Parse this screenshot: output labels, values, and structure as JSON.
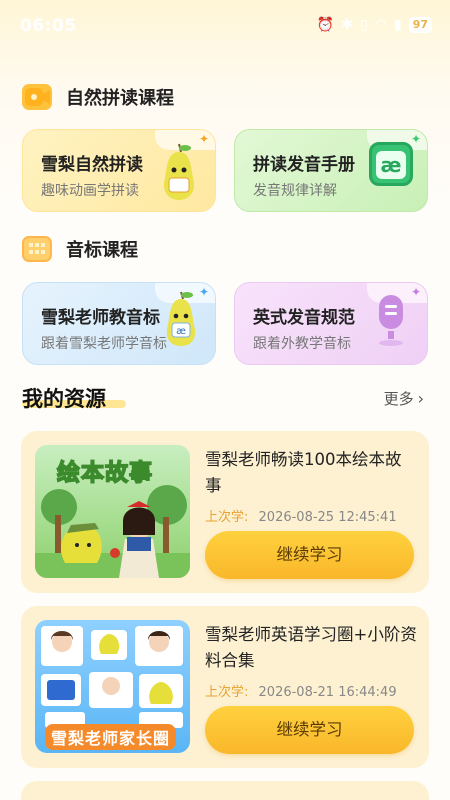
{
  "status": {
    "time": "06:05",
    "battery": "97"
  },
  "sections": {
    "phonics": "自然拼读课程",
    "phonetic": "音标课程"
  },
  "cards": [
    {
      "title": "雪梨自然拼读",
      "subtitle": "趣味动画学拼读"
    },
    {
      "title": "拼读发音手册",
      "subtitle": "发音规律详解"
    },
    {
      "title": "雪梨老师教音标",
      "subtitle": "跟着雪梨老师学音标"
    },
    {
      "title": "英式发音规范",
      "subtitle": "跟着外教学音标"
    }
  ],
  "resources": {
    "heading": "我的资源",
    "more": "更多",
    "items": [
      {
        "title": "雪梨老师畅读100本绘本故事",
        "last_label": "上次学:",
        "last_time": "2026-08-25 12:45:41",
        "button": "继续学习",
        "thumb_text": "绘本故事"
      },
      {
        "title": "雪梨老师英语学习圈+小阶资料合集",
        "last_label": "上次学:",
        "last_time": "2026-08-21 16:44:49",
        "button": "继续学习",
        "thumb_text": "雪梨老师家长圈"
      }
    ]
  },
  "icons": {
    "ae_glyph": "æ"
  },
  "colors": {
    "accent": "#f9b72a",
    "card_yellow": "#fff0b8",
    "card_green": "#d8f5c9",
    "card_blue": "#dbeefb",
    "card_purple": "#f4dcf7"
  }
}
